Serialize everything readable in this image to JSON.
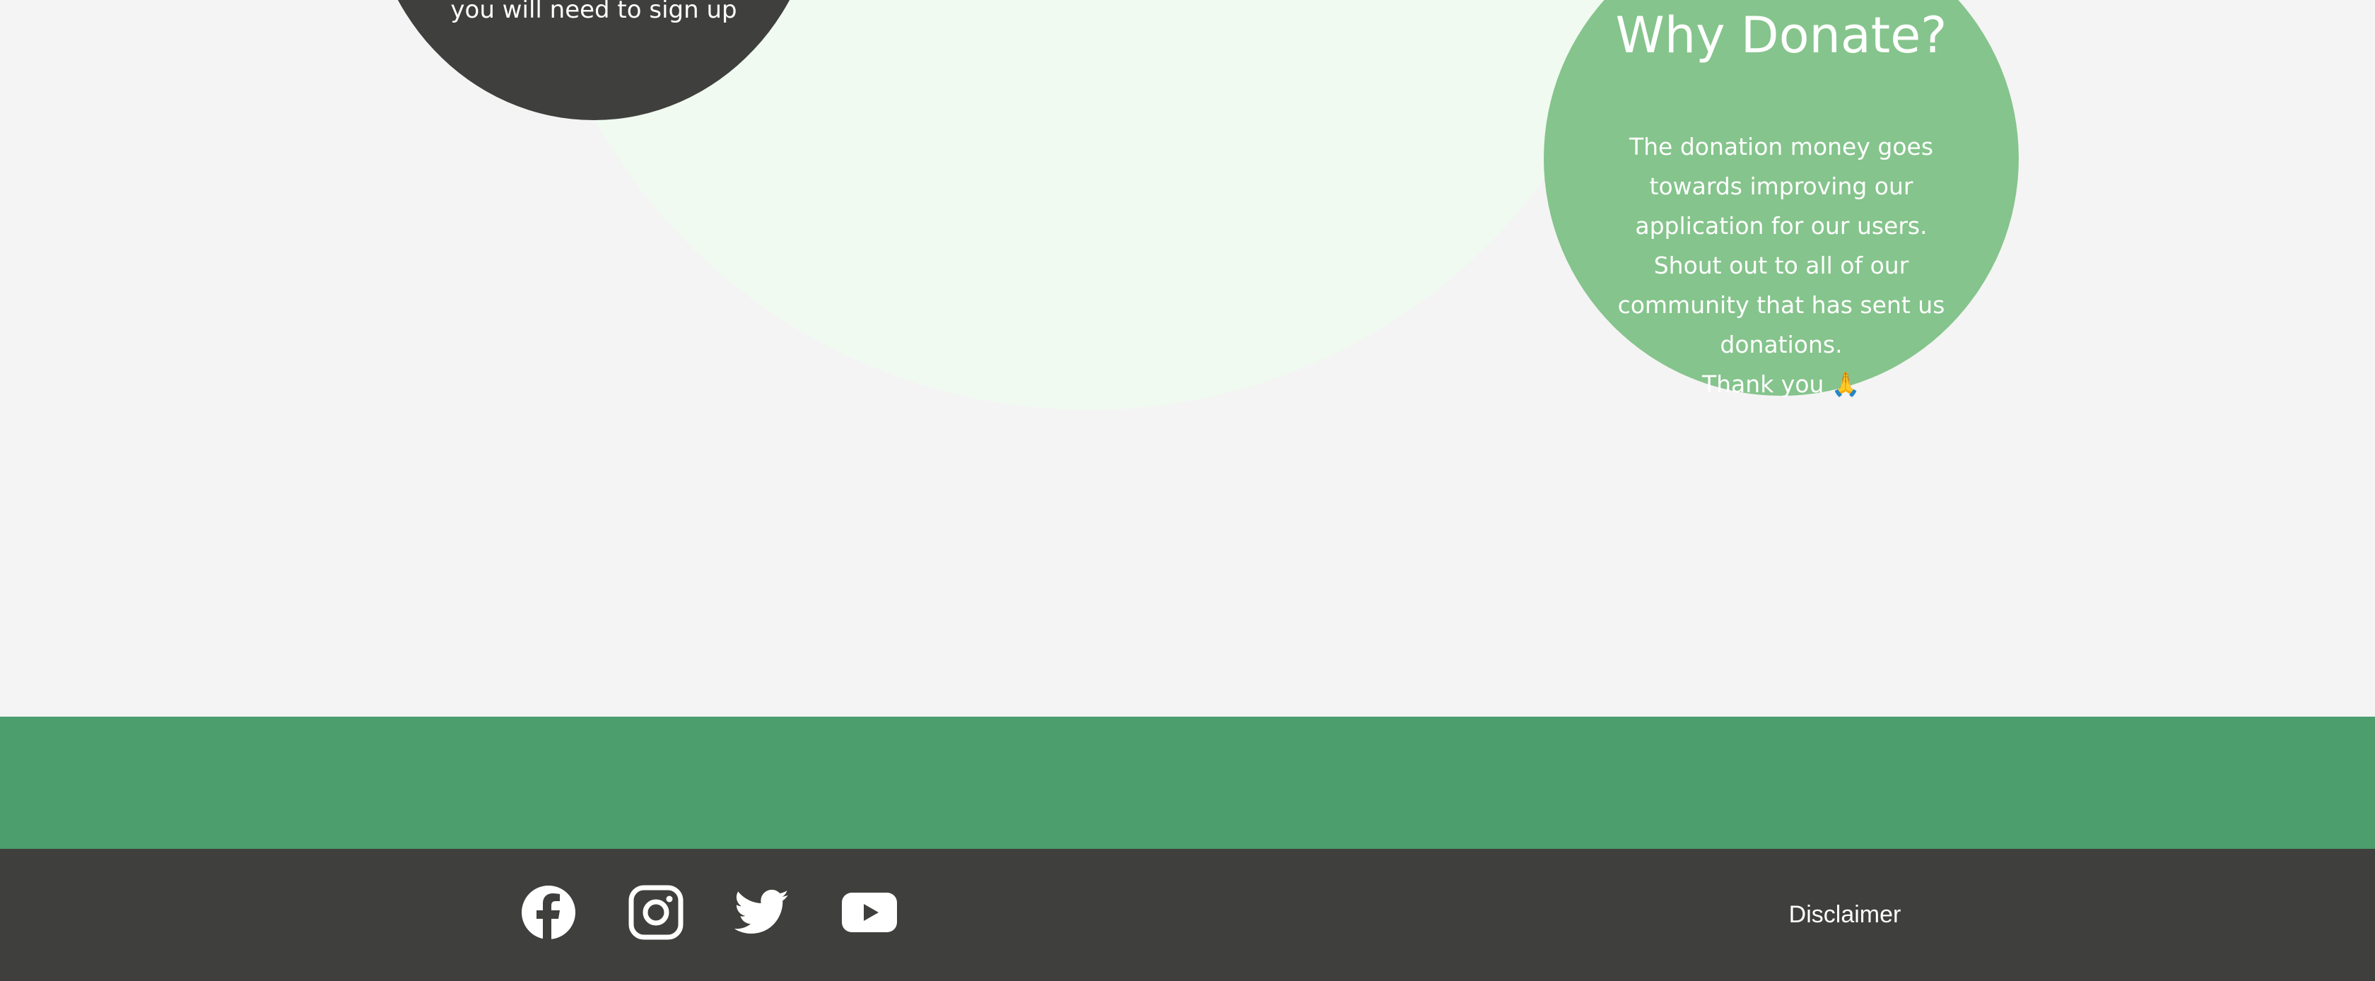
{
  "signup_circle": {
    "text": "you will need to sign up"
  },
  "donate_circle": {
    "title": "Why Donate?",
    "body": "The donation money goes\ntowards improving our\napplication for our users.\nShout out to all of our\ncommunity that has sent us\ndonations.\nThank you 🙏"
  },
  "footer": {
    "social_icons": [
      "facebook-icon",
      "instagram-icon",
      "twitter-icon",
      "youtube-icon"
    ],
    "disclaimer_label": "Disclaimer"
  },
  "colors": {
    "page_background": "#f4f4f4",
    "pale_circle": "#f0faf1",
    "dark_circle": "#3f403d",
    "donate_circle": "#85c48c",
    "green_band": "#4c9e6d",
    "footer_background": "#3f403d",
    "text_on_color": "#ffffff"
  }
}
